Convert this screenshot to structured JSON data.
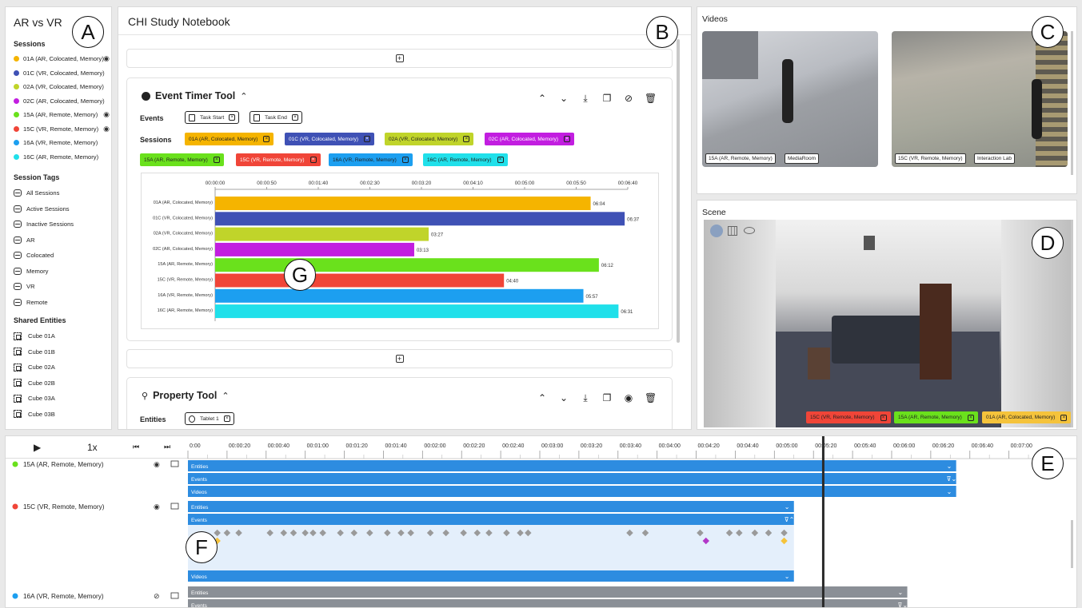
{
  "left": {
    "title": "AR vs VR",
    "sessions_header": "Sessions",
    "sessions": [
      {
        "label": "01A (AR, Colocated, Memory)",
        "color": "#f5b400",
        "eye": true
      },
      {
        "label": "01C (VR, Colocated, Memory)",
        "color": "#3f51b5",
        "eye": false
      },
      {
        "label": "02A (VR, Colocated, Memory)",
        "color": "#c0d42a",
        "eye": false
      },
      {
        "label": "02C (AR, Colocated, Memory)",
        "color": "#c21ee0",
        "eye": false
      },
      {
        "label": "15A (AR, Remote, Memory)",
        "color": "#6ae11c",
        "eye": true
      },
      {
        "label": "15C (VR, Remote, Memory)",
        "color": "#f04538",
        "eye": true
      },
      {
        "label": "16A (VR, Remote, Memory)",
        "color": "#1c9ff0",
        "eye": false
      },
      {
        "label": "16C (AR, Remote, Memory)",
        "color": "#20e0ea",
        "eye": false
      }
    ],
    "tags_header": "Session Tags",
    "tags": [
      "All Sessions",
      "Active Sessions",
      "Inactive Sessions",
      "AR",
      "Colocated",
      "Memory",
      "VR",
      "Remote"
    ],
    "entities_header": "Shared Entities",
    "entities": [
      "Cube 01A",
      "Cube 01B",
      "Cube 02A",
      "Cube 02B",
      "Cube 03A",
      "Cube 03B"
    ]
  },
  "notebook": {
    "title": "CHI Study Notebook",
    "event_tool": {
      "title": "Event Timer Tool",
      "events_label": "Events",
      "events": [
        "Task Start",
        "Task End"
      ],
      "sessions_label": "Sessions",
      "session_chips": [
        {
          "label": "01A (AR, Colocated, Memory)",
          "color": "#f5b400",
          "text": "#222"
        },
        {
          "label": "01C (VR, Colocated, Memory)",
          "color": "#3f51b5",
          "text": "#fff"
        },
        {
          "label": "02A (VR, Colocated, Memory)",
          "color": "#c0d42a",
          "text": "#222"
        },
        {
          "label": "02C (AR, Colocated, Memory)",
          "color": "#c21ee0",
          "text": "#fff"
        },
        {
          "label": "15A (AR, Remote, Memory)",
          "color": "#6ae11c",
          "text": "#222"
        },
        {
          "label": "15C (VR, Remote, Memory)",
          "color": "#f04538",
          "text": "#fff"
        },
        {
          "label": "16A (VR, Remote, Memory)",
          "color": "#1c9ff0",
          "text": "#222"
        },
        {
          "label": "16C (AR, Remote, Memory)",
          "color": "#20e0ea",
          "text": "#222"
        }
      ]
    },
    "property_tool": {
      "title": "Property Tool",
      "entities_label": "Entities",
      "entity": "Tablet 1"
    }
  },
  "chart_data": {
    "type": "bar",
    "orientation": "horizontal",
    "x_ticks": [
      "00:00:00",
      "00:00:50",
      "00:01:40",
      "00:02:30",
      "00:03:20",
      "00:04:10",
      "00:05:00",
      "00:05:50",
      "00:06:40"
    ],
    "xlim": [
      0,
      400
    ],
    "categories": [
      "01A (AR, Colocated, Memory)",
      "01C (VR, Colocated, Memory)",
      "02A (VR, Colocated, Memory)",
      "02C (AR, Colocated, Memory)",
      "15A (AR, Remote, Memory)",
      "15C (VR, Remote, Memory)",
      "16A (VR, Remote, Memory)",
      "16C (AR, Remote, Memory)"
    ],
    "values_seconds": [
      364,
      397,
      207,
      193,
      372,
      280,
      357,
      391
    ],
    "data_labels": [
      "06:04",
      "06:37",
      "03:27",
      "03:13",
      "06:12",
      "04:40",
      "05:57",
      "06:31"
    ],
    "colors": [
      "#f5b400",
      "#3f51b5",
      "#c0d42a",
      "#c21ee0",
      "#6ae11c",
      "#f04538",
      "#1c9ff0",
      "#20e0ea"
    ]
  },
  "videos": {
    "title": "Videos",
    "items": [
      {
        "session": "15A (AR, Remote, Memory)",
        "room": "MediaRoom"
      },
      {
        "session": "15C (VR, Remote, Memory)",
        "room": "Interaction Lab"
      }
    ]
  },
  "scene": {
    "title": "Scene",
    "chips": [
      {
        "label": "15C (VR, Remote, Memory)",
        "color": "#f04538"
      },
      {
        "label": "15A (AR, Remote, Memory)",
        "color": "#6ae11c"
      },
      {
        "label": "01A (AR, Colocated, Memory)",
        "color": "#f5c33b"
      }
    ]
  },
  "timeline": {
    "speed": "1x",
    "ticks": [
      "0:00",
      "00:00:20",
      "00:00:40",
      "00:01:00",
      "00:01:20",
      "00:01:40",
      "00:02:00",
      "00:02:20",
      "00:02:40",
      "00:03:00",
      "00:03:20",
      "00:03:40",
      "00:04:00",
      "00:04:20",
      "00:04:40",
      "00:05:00",
      "00:05:20",
      "00:05:40",
      "00:06:00",
      "00:06:20",
      "00:06:40",
      "00:07:00"
    ],
    "playhead_seconds": 325,
    "rows": [
      {
        "label": "15A (AR, Remote, Memory)",
        "color": "#6ae11c",
        "tracks": [
          "Entities",
          "Events",
          "Videos"
        ]
      },
      {
        "label": "15C (VR, Remote, Memory)",
        "color": "#f04538",
        "tracks": [
          "Entities",
          "Events",
          "Videos"
        ]
      },
      {
        "label": "16A (VR, Remote, Memory)",
        "color": "#1c9ff0",
        "tracks": [
          "Entities",
          "Events"
        ]
      }
    ]
  },
  "callouts": [
    "A",
    "B",
    "C",
    "D",
    "E",
    "F",
    "G"
  ]
}
